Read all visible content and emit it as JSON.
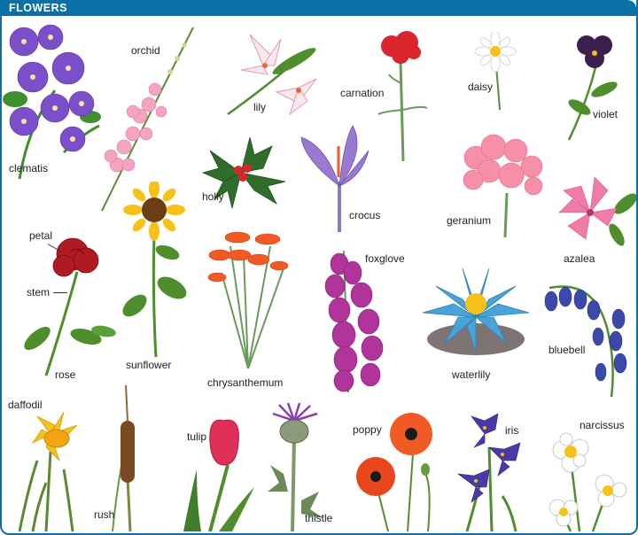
{
  "header": {
    "title": "FLOWERS"
  },
  "labels": {
    "clematis": "clematis",
    "orchid": "orchid",
    "lily": "lily",
    "carnation": "carnation",
    "daisy": "daisy",
    "violet": "violet",
    "holly": "holly",
    "crocus": "crocus",
    "geranium": "geranium",
    "petal": "petal",
    "stem": "stem",
    "rose": "rose",
    "sunflower": "sunflower",
    "chrysanthemum": "chrysanthemum",
    "foxglove": "foxglove",
    "waterlily": "waterlily",
    "azalea": "azalea",
    "bluebell": "bluebell",
    "daffodil": "daffodil",
    "rush": "rush",
    "tulip": "tulip",
    "thistle": "thistle",
    "poppy": "poppy",
    "iris": "iris",
    "narcissus": "narcissus"
  },
  "colors": {
    "header": "#0a71a8",
    "leaf": "#3f8f2e",
    "purple": "#7b4fc9",
    "pink": "#f07aa8",
    "red": "#d8262c",
    "yellow": "#f6c21a",
    "orange": "#f15a24",
    "blue": "#4aa3d8"
  }
}
